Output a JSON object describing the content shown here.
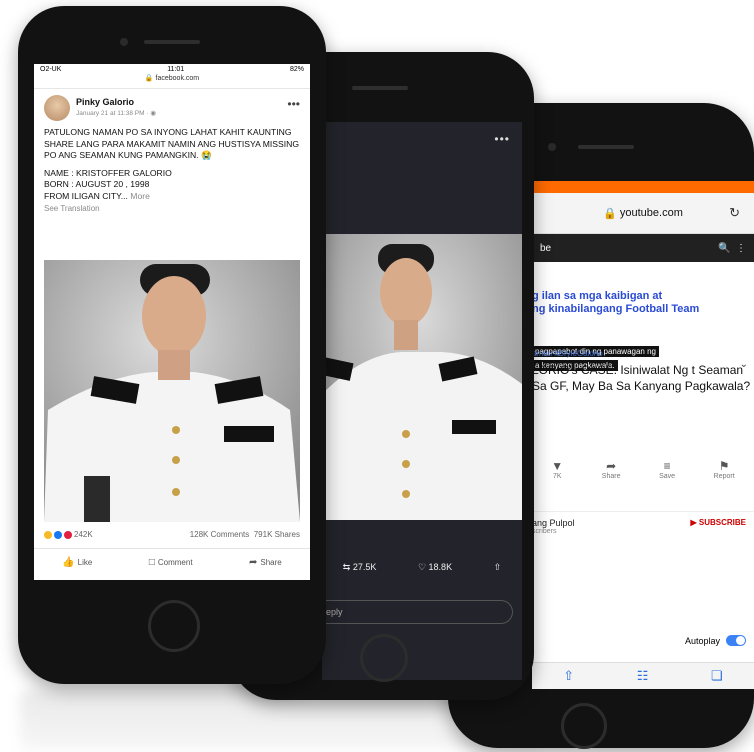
{
  "phone1": {
    "status": {
      "carrier": "O2-UK",
      "time": "11:01",
      "battery": "82%"
    },
    "url": "facebook.com",
    "post": {
      "author": "Pinky Galorio",
      "time": "January 21 at 11:38 PM",
      "paragraph1": "PATULONG NAMAN PO SA INYONG LAHAT KAHIT KAUNTING SHARE LANG PARA MAKAMIT NAMIN ANG HUSTISYA MISSING PO ANG SEAMAN KUNG PAMANGKIN.",
      "name_line": "NAME : KRISTOFFER GALORIO",
      "born_line": "BORN : AUGUST 20 , 1998",
      "from_line": "FROM ILIGAN CITY...",
      "more": "More",
      "see_translation": "See Translation",
      "reactions": "242K",
      "comments": "128K Comments",
      "shares": "791K Shares",
      "actions": {
        "like": "Like",
        "comment": "Comment",
        "share": "Share"
      }
    }
  },
  "phone2": {
    "retweets": "27.5K",
    "likes": "18.8K",
    "reply_placeholder": "eply"
  },
  "phone3": {
    "url": "youtube.com",
    "app_label": "be",
    "headline_line1": "g ilan sa mga kaibigan at",
    "headline_line2": "ng kinabilangang Football Team",
    "caption1": "pagpapabot din ng panawagan ng",
    "caption2": "a kanyang pagkawala.",
    "hashtags": "eman  #BryleGalorio",
    "title": "LORIO's CASE: Isiniwalat Ng t Seaman Sa GF, May Ba Sa Kanyang Pagkawala?",
    "actions": [
      "7K",
      "Share",
      "Save",
      "Report"
    ],
    "channel": "ang Pulpol",
    "subscribers": "scribers",
    "subscribe": "SUBSCRIBE",
    "autoplay": "Autoplay"
  }
}
